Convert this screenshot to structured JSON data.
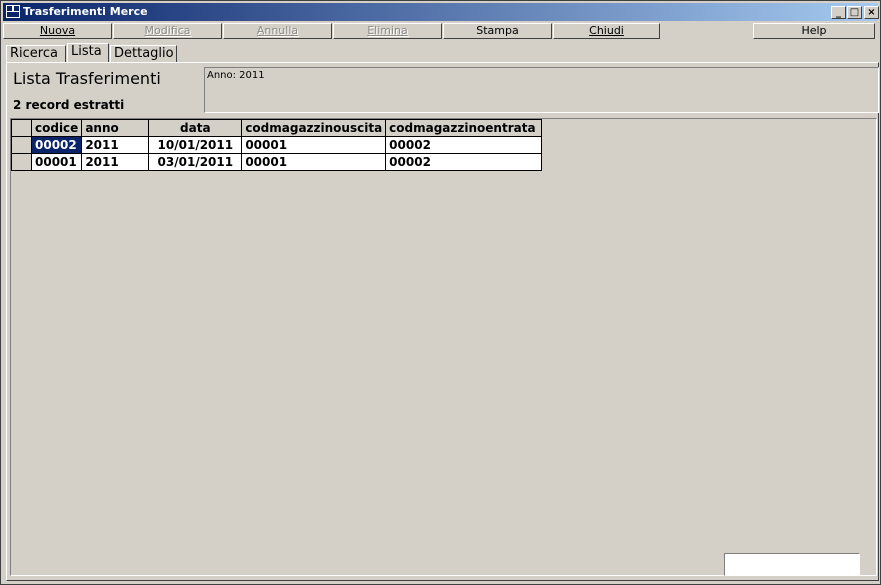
{
  "window": {
    "title": "Trasferimenti Merce",
    "icon": "app-icon"
  },
  "toolbar": {
    "buttons": [
      {
        "label": "Nuova",
        "enabled": true
      },
      {
        "label": "Modifica",
        "enabled": false
      },
      {
        "label": "Annulla",
        "enabled": false
      },
      {
        "label": "Elimina",
        "enabled": false
      },
      {
        "label": "Stampa",
        "enabled": true
      },
      {
        "label": "Chiudi",
        "enabled": true
      },
      {
        "label": "Help",
        "enabled": true
      }
    ]
  },
  "tabs": [
    {
      "label": "Ricerca",
      "active": false
    },
    {
      "label": "Lista",
      "active": true
    },
    {
      "label": "Dettaglio",
      "active": false
    }
  ],
  "list": {
    "title": "Lista Trasferimenti",
    "record_count": "2 record estratti",
    "filter_text": "Anno: 2011",
    "columns": [
      "codice",
      "anno",
      "data",
      "codmagazzinouscita",
      "codmagazzinoentrata"
    ],
    "rows": [
      [
        "00002",
        "2011",
        "10/01/2011",
        "00001",
        "00002"
      ],
      [
        "00001",
        "2011",
        "03/01/2011",
        "00001",
        "00002"
      ]
    ],
    "selected_cell": "00002"
  },
  "colors": {
    "titlebar_start": "#0a246a",
    "titlebar_end": "#a6caf0",
    "selection": "#0a246a",
    "face": "#d4d0c8"
  }
}
